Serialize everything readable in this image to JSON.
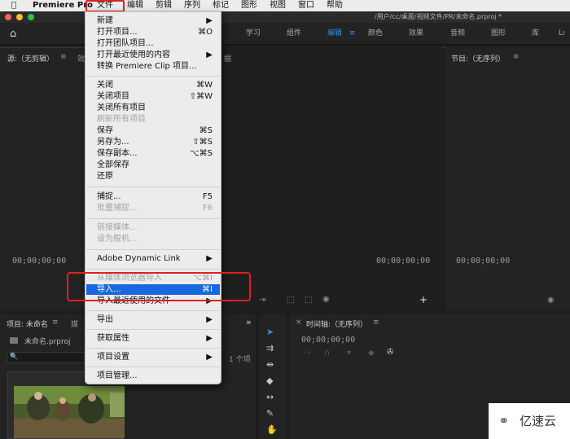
{
  "menubar": {
    "apple_icon": "",
    "app_name": "Premiere Pro",
    "items": [
      "文件",
      "编辑",
      "剪辑",
      "序列",
      "标记",
      "图形",
      "视图",
      "窗口",
      "帮助"
    ]
  },
  "titlebar": {
    "path": "/用户/cc/桌面/视频文件/PR/未命名.prproj *"
  },
  "workspaces": {
    "items": [
      "学习",
      "组件",
      "编辑",
      "颜色",
      "效果",
      "音频",
      "图形",
      "库",
      "Lı"
    ],
    "active": "编辑",
    "active_menu_icon": "≡"
  },
  "source_panel": {
    "title": "源:（无剪辑）",
    "menu_icon": "≡",
    "next_tab": "效",
    "tab_right": "据",
    "timecode": "00;00;00;00"
  },
  "center_panel": {
    "timecode": "00;00;00;00"
  },
  "program_panel": {
    "title": "节目:（无序列）",
    "menu_icon": "≡",
    "timecode": "00;00;00;00"
  },
  "project_panel": {
    "title": "项目: 未命名",
    "menu_icon": "≡",
    "next_tab": "媒",
    "overflow_icon": "»",
    "file_name": "未命名.prproj",
    "search_icon": "🔍",
    "item_count": "1 个项"
  },
  "timeline_panel": {
    "close_icon": "×",
    "title": "时间轴:（无序列）",
    "menu_icon": "≡",
    "timecode": "00;00;00;00"
  },
  "file_menu": {
    "items": [
      {
        "label": "新建",
        "shortcut": "▶",
        "state": "normal"
      },
      {
        "label": "打开项目...",
        "shortcut": "⌘O",
        "state": "normal"
      },
      {
        "label": "打开团队项目...",
        "shortcut": "",
        "state": "normal"
      },
      {
        "label": "打开最近使用的内容",
        "shortcut": "▶",
        "state": "normal"
      },
      {
        "label": "转换 Premiere Clip 项目...",
        "shortcut": "",
        "state": "normal"
      },
      {
        "label": "关闭",
        "shortcut": "⌘W",
        "state": "normal"
      },
      {
        "label": "关闭项目",
        "shortcut": "⇧⌘W",
        "state": "normal"
      },
      {
        "label": "关闭所有项目",
        "shortcut": "",
        "state": "normal"
      },
      {
        "label": "刷新所有项目",
        "shortcut": "",
        "state": "disabled"
      },
      {
        "label": "保存",
        "shortcut": "⌘S",
        "state": "normal"
      },
      {
        "label": "另存为...",
        "shortcut": "⇧⌘S",
        "state": "normal"
      },
      {
        "label": "保存副本...",
        "shortcut": "⌥⌘S",
        "state": "normal"
      },
      {
        "label": "全部保存",
        "shortcut": "",
        "state": "normal"
      },
      {
        "label": "还原",
        "shortcut": "",
        "state": "normal"
      },
      {
        "label": "捕捉...",
        "shortcut": "F5",
        "state": "normal"
      },
      {
        "label": "批量捕捉...",
        "shortcut": "F6",
        "state": "disabled"
      },
      {
        "label": "链接媒体...",
        "shortcut": "",
        "state": "disabled"
      },
      {
        "label": "设为脱机...",
        "shortcut": "",
        "state": "disabled"
      },
      {
        "label": "Adobe Dynamic Link",
        "shortcut": "▶",
        "state": "normal"
      },
      {
        "label": "从媒体浏览器导入",
        "shortcut": "⌥⌘I",
        "state": "disabled"
      },
      {
        "label": "导入...",
        "shortcut": "⌘I",
        "state": "highlighted"
      },
      {
        "label": "导入最近使用的文件",
        "shortcut": "▶",
        "state": "normal"
      },
      {
        "label": "导出",
        "shortcut": "▶",
        "state": "normal"
      },
      {
        "label": "获取属性",
        "shortcut": "▶",
        "state": "normal"
      },
      {
        "label": "项目设置",
        "shortcut": "▶",
        "state": "normal"
      },
      {
        "label": "项目管理...",
        "shortcut": "",
        "state": "normal"
      }
    ]
  },
  "tools": [
    "selection-tool",
    "track-select-tool",
    "ripple-edit-tool",
    "razor-tool",
    "slip-tool",
    "pen-tool",
    "hand-tool"
  ],
  "watermark": {
    "text": "亿速云"
  }
}
